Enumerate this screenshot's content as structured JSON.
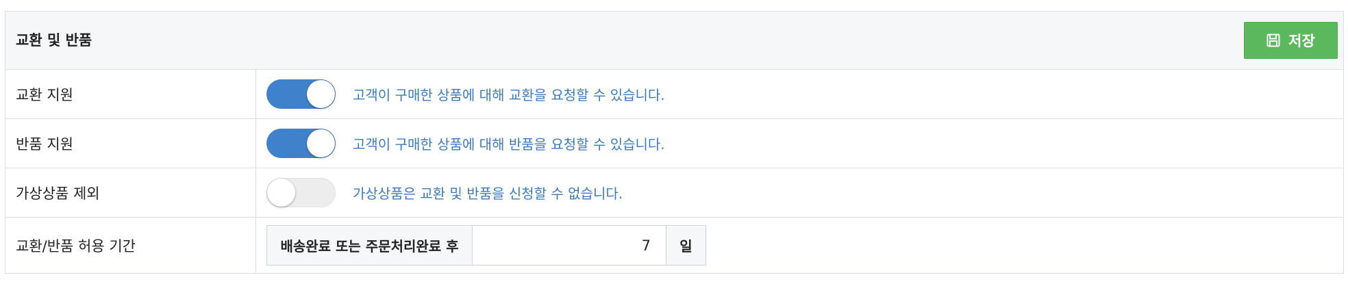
{
  "panel": {
    "title": "교환 및 반품",
    "save_label": "저장",
    "accent_color": "#5cb85c"
  },
  "rows": [
    {
      "label": "교환 지원",
      "toggle_on": true,
      "description": "고객이 구매한 상품에 대해 교환을 요청할 수 있습니다."
    },
    {
      "label": "반품 지원",
      "toggle_on": true,
      "description": "고객이 구매한 상품에 대해 반품을 요청할 수 있습니다."
    },
    {
      "label": "가상상품 제외",
      "toggle_on": false,
      "description": "가상상품은 교환 및 반품을 신청할 수 없습니다."
    }
  ],
  "period": {
    "label": "교환/반품 허용 기간",
    "prefix": "배송완료 또는 주문처리완료 후",
    "value": "7",
    "unit": "일"
  },
  "colors": {
    "toggle_on": "#3f82cb",
    "description_text": "#3a7bc0"
  },
  "icons": {
    "save": "floppy-disk-icon"
  }
}
